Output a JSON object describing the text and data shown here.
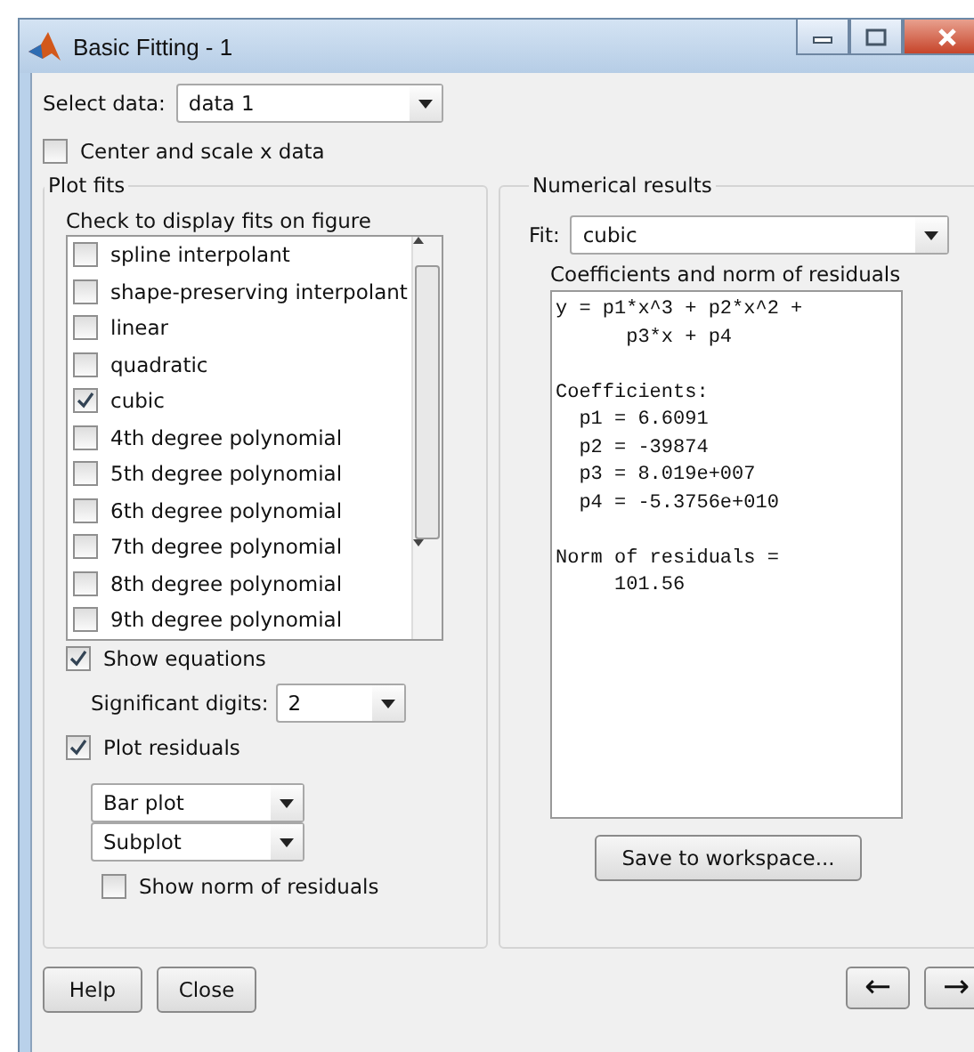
{
  "window": {
    "title": "Basic Fitting - 1"
  },
  "select_data": {
    "label": "Select data:",
    "value": "data 1"
  },
  "center_scale": {
    "label": "Center and scale x data",
    "checked": false
  },
  "plot_fits": {
    "title": "Plot fits",
    "list_label": "Check to display fits on figure",
    "fits": [
      {
        "label": "spline interpolant",
        "checked": false
      },
      {
        "label": "shape-preserving interpolant",
        "checked": false
      },
      {
        "label": "linear",
        "checked": false
      },
      {
        "label": "quadratic",
        "checked": false
      },
      {
        "label": "cubic",
        "checked": true
      },
      {
        "label": "4th degree polynomial",
        "checked": false
      },
      {
        "label": "5th degree polynomial",
        "checked": false
      },
      {
        "label": "6th degree polynomial",
        "checked": false
      },
      {
        "label": "7th degree polynomial",
        "checked": false
      },
      {
        "label": "8th degree polynomial",
        "checked": false
      },
      {
        "label": "9th degree polynomial",
        "checked": false
      }
    ],
    "show_equations": {
      "label": "Show equations",
      "checked": true
    },
    "significant_digits": {
      "label": "Significant digits:",
      "value": "2"
    },
    "plot_residuals": {
      "label": "Plot residuals",
      "checked": true
    },
    "residual_plot_type": "Bar plot",
    "residual_plot_location": "Subplot",
    "show_norm": {
      "label": "Show norm of residuals",
      "checked": false
    }
  },
  "numerical_results": {
    "title": "Numerical results",
    "fit_label": "Fit:",
    "fit_value": "cubic",
    "results_label": "Coefficients and norm of residuals",
    "results_blocks": [
      [
        "y = p1*x^3 + p2*x^2 +",
        "      p3*x + p4"
      ],
      [
        "Coefficients:",
        "  p1 = 6.6091",
        "  p2 = -39874",
        "  p3 = 8.019e+007",
        "  p4 = -5.3756e+010"
      ],
      [
        "Norm of residuals =",
        "     101.56"
      ]
    ],
    "save_button": "Save to workspace..."
  },
  "buttons": {
    "help": "Help",
    "close": "Close",
    "back": "←",
    "forward": "→"
  }
}
